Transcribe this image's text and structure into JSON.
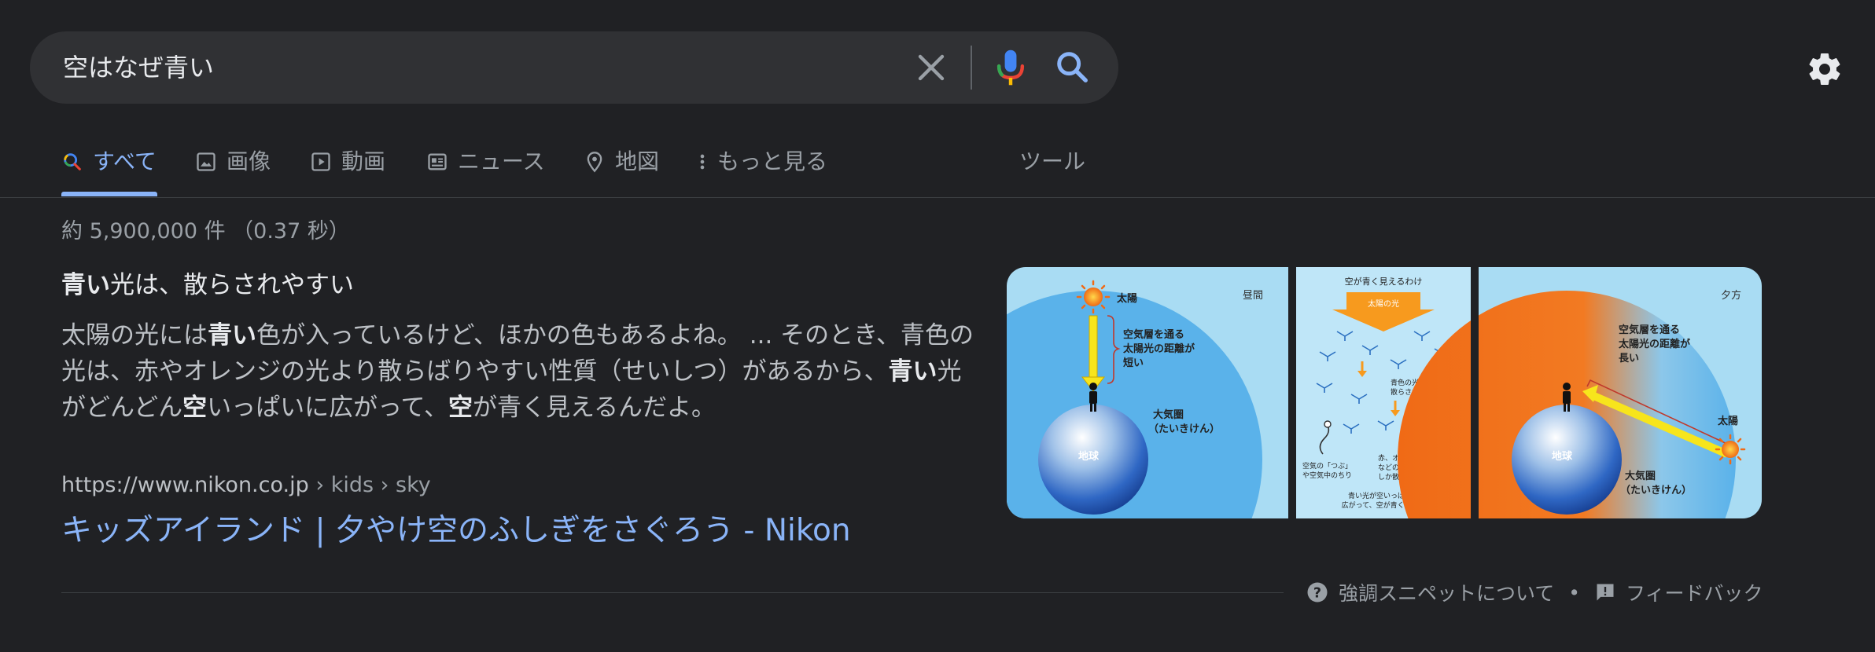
{
  "search": {
    "query": "空はなぜ青い"
  },
  "tabs": [
    {
      "label": "すべて",
      "icon": "search-icon",
      "active": true
    },
    {
      "label": "画像",
      "icon": "image-icon"
    },
    {
      "label": "動画",
      "icon": "play-icon"
    },
    {
      "label": "ニュース",
      "icon": "news-icon"
    },
    {
      "label": "地図",
      "icon": "map-pin-icon"
    },
    {
      "label": "もっと見る",
      "icon": "more-vert-icon"
    }
  ],
  "tools_label": "ツール",
  "stats": "約 5,900,000 件 （0.37 秒）",
  "snippet": {
    "heading_bold": "青い",
    "heading_rest": "光は、散らされやすい",
    "body": {
      "p1": "太陽の光には",
      "b1": "青い",
      "p2": "色が入っているけど、ほかの色もあるよね。 ... そのとき、青色の光は、赤やオレンジの光より散らばりやすい性質（せいしつ）があるから、",
      "b2": "青い",
      "p3": "光がどんどん",
      "b3": "空",
      "p4": "いっぱいに広がって、",
      "b4": "空",
      "p5": "が青く見えるんだよ。"
    }
  },
  "result": {
    "cite_domain": "https://www.nikon.co.jp",
    "cite_path": " › kids › sky",
    "title": "キッズアイランド | 夕やけ空のふしぎをさぐろう - Nikon"
  },
  "images": {
    "left": {
      "sun_label": "太陽",
      "time_label": "昼間",
      "distance_label_1": "空気層を通る",
      "distance_label_2": "太陽光の距離が",
      "distance_label_3": "短い",
      "atmosphere_label_1": "大気圏",
      "atmosphere_label_2": "（たいきけん）",
      "earth_label": "地球"
    },
    "middle": {
      "title": "空が青く見えるわけ",
      "sunlight_label": "太陽の光",
      "blue_text_1": "青色の光は",
      "blue_text_2": "散らされやすい",
      "particle_text_1": "空気の「つぶ」",
      "particle_text_2": "や空気中のちり",
      "red_text_1": "赤、オレンジ、黄色",
      "red_text_2": "などの光は、少し",
      "red_text_3": "しか散らされない",
      "bottom_text_1": "青い光が空いっぱいに",
      "bottom_text_2": "広がって、空が青く見える"
    },
    "right": {
      "time_label": "夕方",
      "distance_label_1": "空気層を通る",
      "distance_label_2": "太陽光の距離が",
      "distance_label_3": "長い",
      "sun_label": "太陽",
      "atmosphere_label_1": "大気圏",
      "atmosphere_label_2": "（たいきけん）",
      "earth_label": "地球"
    }
  },
  "footer": {
    "about_label": "強調スニペットについて",
    "separator": "•",
    "feedback_label": "フィードバック"
  },
  "colors": {
    "background": "#202124",
    "link": "#8ab4f8",
    "search_bg": "#303134",
    "sky": "#a9dcf3",
    "atmosphere": "#5ab2ea",
    "sunset": "#f06a16"
  }
}
